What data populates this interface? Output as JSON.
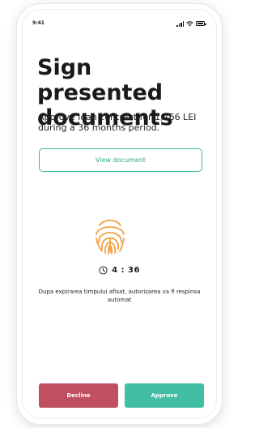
{
  "status_bar": {
    "time": "9:41"
  },
  "header": {
    "title": "Sign presented documents",
    "subtitle": "Approve loan contract for 1,766 LEI during a 36 months period."
  },
  "view_document": {
    "label": "View document"
  },
  "timer": {
    "value": "4 : 36"
  },
  "notice": {
    "text": "Dupa expirarea timpului afisat, autorizarea va fi respinsa automat"
  },
  "actions": {
    "decline_label": "Decline",
    "approve_label": "Approve"
  },
  "colors": {
    "accent": "#3cb8a0",
    "decline": "#c0505f",
    "approve": "#42bea4",
    "fingerprint": "#f5a040"
  },
  "icons": [
    "signal-icon",
    "wifi-icon",
    "battery-icon",
    "fingerprint-icon",
    "clock-icon"
  ]
}
